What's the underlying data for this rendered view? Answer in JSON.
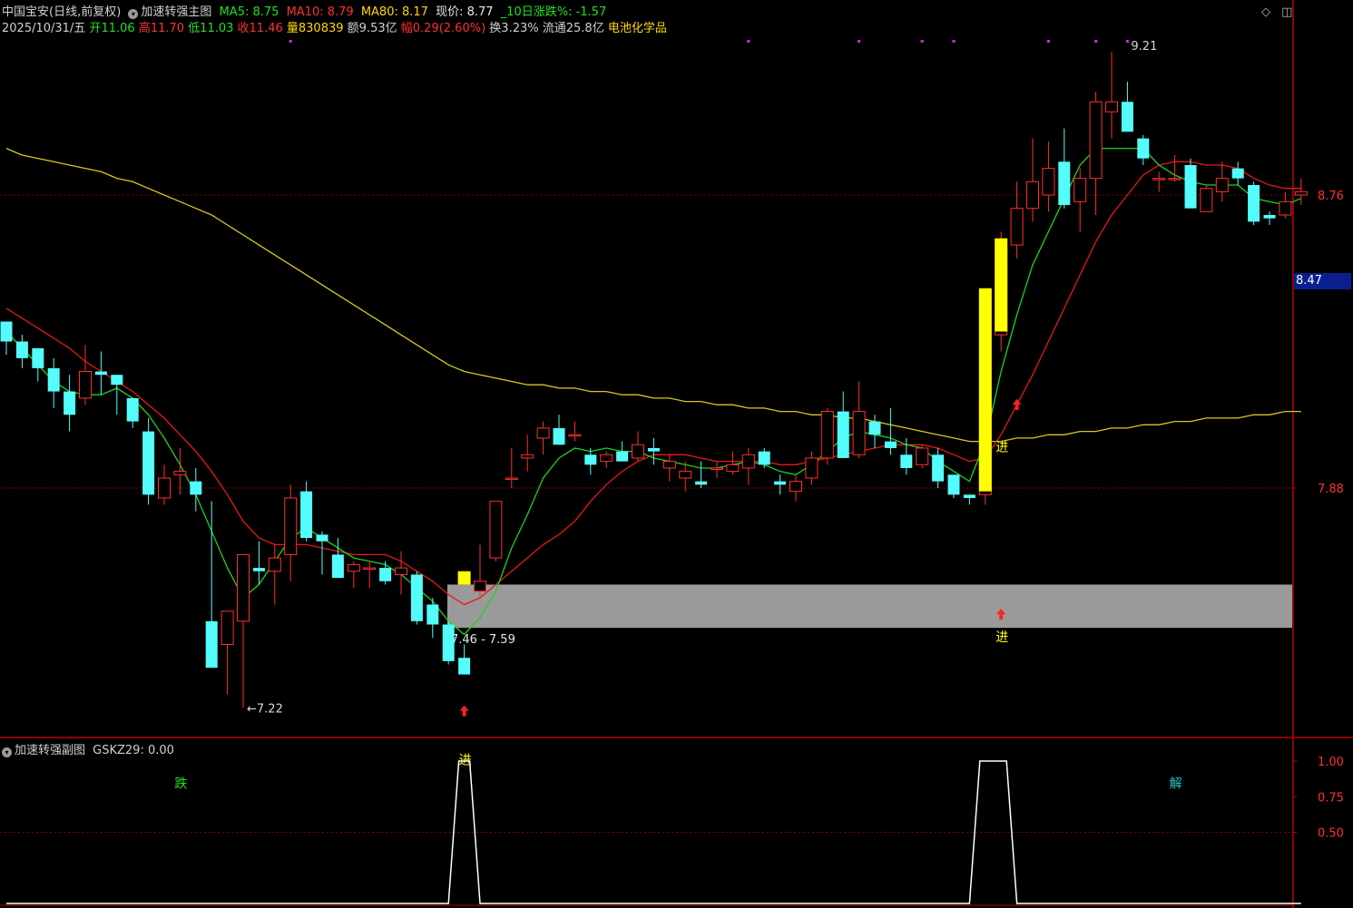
{
  "header": {
    "stock": "中国宝安(日线,前复权)",
    "indicator": "加速转强主图",
    "ma5": "MA5: 8.75",
    "ma10": "MA10: 8.79",
    "ma80": "MA80: 8.17",
    "price": "现价: 8.77",
    "change10": "_10日涨跌%: -1.57"
  },
  "info": {
    "date": "2025/10/31/五",
    "open": "开11.06",
    "high": "高11.70",
    "low": "低11.03",
    "close": "收11.46",
    "volume": "量830839",
    "amount": "额9.53亿",
    "range": "幅0.29(2.60%)",
    "turnover": "换3.23%",
    "float": "流通25.8亿",
    "sector": "电池化学品"
  },
  "sub_header": {
    "indicator": "加速转强副图",
    "value": "GSKZ29: 0.00"
  },
  "current_price_label": "8.47",
  "colors": {
    "up": "#ff3030",
    "down": "#54fcfc",
    "ma5": "#1fd11f",
    "ma10": "#e81818",
    "ma80": "#d8c820",
    "signal": "#ffff00",
    "band": "#9a9a9a",
    "grid": "#8b0000",
    "axis": "#c00000"
  },
  "chart_data": [
    {
      "type": "candlestick",
      "title": "加速转强主图",
      "series_names": [
        "MA5",
        "MA10",
        "MA80"
      ],
      "ylim": [
        7.0,
        9.3
      ],
      "yticks": [
        7.88,
        8.76
      ],
      "candles": [
        {
          "o": 8.38,
          "h": 8.38,
          "l": 8.28,
          "c": 8.32
        },
        {
          "o": 8.32,
          "h": 8.34,
          "l": 8.24,
          "c": 8.27
        },
        {
          "o": 8.3,
          "h": 8.3,
          "l": 8.2,
          "c": 8.24
        },
        {
          "o": 8.24,
          "h": 8.27,
          "l": 8.12,
          "c": 8.17
        },
        {
          "o": 8.17,
          "h": 8.22,
          "l": 8.05,
          "c": 8.1
        },
        {
          "o": 8.15,
          "h": 8.31,
          "l": 8.13,
          "c": 8.23
        },
        {
          "o": 8.23,
          "h": 8.29,
          "l": 8.16,
          "c": 8.22
        },
        {
          "o": 8.22,
          "h": 8.22,
          "l": 8.1,
          "c": 8.19
        },
        {
          "o": 8.15,
          "h": 8.15,
          "l": 8.06,
          "c": 8.08
        },
        {
          "o": 8.05,
          "h": 8.09,
          "l": 7.83,
          "c": 7.86
        },
        {
          "o": 7.85,
          "h": 7.95,
          "l": 7.83,
          "c": 7.91
        },
        {
          "o": 7.92,
          "h": 8.0,
          "l": 7.86,
          "c": 7.93
        },
        {
          "o": 7.9,
          "h": 7.94,
          "l": 7.81,
          "c": 7.86
        },
        {
          "o": 7.48,
          "h": 7.84,
          "l": 7.45,
          "c": 7.34
        },
        {
          "o": 7.41,
          "h": 7.5,
          "l": 7.26,
          "c": 7.51
        },
        {
          "o": 7.48,
          "h": 7.68,
          "l": 7.22,
          "c": 7.68
        },
        {
          "o": 7.64,
          "h": 7.72,
          "l": 7.59,
          "c": 7.63
        },
        {
          "o": 7.63,
          "h": 7.71,
          "l": 7.53,
          "c": 7.67
        },
        {
          "o": 7.68,
          "h": 7.89,
          "l": 7.6,
          "c": 7.85
        },
        {
          "o": 7.87,
          "h": 7.9,
          "l": 7.72,
          "c": 7.73
        },
        {
          "o": 7.74,
          "h": 7.75,
          "l": 7.62,
          "c": 7.72
        },
        {
          "o": 7.68,
          "h": 7.73,
          "l": 7.62,
          "c": 7.61
        },
        {
          "o": 7.63,
          "h": 7.66,
          "l": 7.58,
          "c": 7.65
        },
        {
          "o": 7.64,
          "h": 7.66,
          "l": 7.58,
          "c": 7.64
        },
        {
          "o": 7.64,
          "h": 7.66,
          "l": 7.59,
          "c": 7.6
        },
        {
          "o": 7.62,
          "h": 7.69,
          "l": 7.56,
          "c": 7.64
        },
        {
          "o": 7.62,
          "h": 7.63,
          "l": 7.47,
          "c": 7.48
        },
        {
          "o": 7.53,
          "h": 7.55,
          "l": 7.43,
          "c": 7.47
        },
        {
          "o": 7.47,
          "h": 7.48,
          "l": 7.35,
          "c": 7.36
        },
        {
          "o": 7.37,
          "h": 7.41,
          "l": 7.33,
          "c": 7.32
        },
        {
          "o": 7.57,
          "h": 7.71,
          "l": 7.55,
          "c": 7.6
        },
        {
          "o": 7.67,
          "h": 7.84,
          "l": 7.66,
          "c": 7.84
        },
        {
          "o": 7.91,
          "h": 8.0,
          "l": 7.88,
          "c": 7.91
        },
        {
          "o": 7.97,
          "h": 8.04,
          "l": 7.93,
          "c": 7.98
        },
        {
          "o": 8.03,
          "h": 8.08,
          "l": 7.98,
          "c": 8.06
        },
        {
          "o": 8.06,
          "h": 8.1,
          "l": 8.01,
          "c": 8.01
        },
        {
          "o": 8.04,
          "h": 8.08,
          "l": 8.02,
          "c": 8.04
        },
        {
          "o": 7.98,
          "h": 8.0,
          "l": 7.92,
          "c": 7.95
        },
        {
          "o": 7.96,
          "h": 7.99,
          "l": 7.94,
          "c": 7.98
        },
        {
          "o": 7.99,
          "h": 8.02,
          "l": 7.96,
          "c": 7.96
        },
        {
          "o": 7.97,
          "h": 8.05,
          "l": 7.96,
          "c": 8.01
        },
        {
          "o": 8.0,
          "h": 8.03,
          "l": 7.95,
          "c": 7.99
        },
        {
          "o": 7.94,
          "h": 7.98,
          "l": 7.9,
          "c": 7.96
        },
        {
          "o": 7.91,
          "h": 7.96,
          "l": 7.87,
          "c": 7.93
        },
        {
          "o": 7.9,
          "h": 7.96,
          "l": 7.88,
          "c": 7.89
        },
        {
          "o": 7.94,
          "h": 7.96,
          "l": 7.91,
          "c": 7.94
        },
        {
          "o": 7.93,
          "h": 7.99,
          "l": 7.92,
          "c": 7.95
        },
        {
          "o": 7.94,
          "h": 8.0,
          "l": 7.89,
          "c": 7.98
        },
        {
          "o": 7.99,
          "h": 8.0,
          "l": 7.94,
          "c": 7.95
        },
        {
          "o": 7.9,
          "h": 7.92,
          "l": 7.86,
          "c": 7.89
        },
        {
          "o": 7.87,
          "h": 7.92,
          "l": 7.84,
          "c": 7.9
        },
        {
          "o": 7.91,
          "h": 7.99,
          "l": 7.89,
          "c": 7.97
        },
        {
          "o": 7.97,
          "h": 8.12,
          "l": 7.95,
          "c": 8.11
        },
        {
          "o": 8.11,
          "h": 8.17,
          "l": 7.98,
          "c": 7.97
        },
        {
          "o": 7.98,
          "h": 8.2,
          "l": 7.97,
          "c": 8.11
        },
        {
          "o": 8.08,
          "h": 8.1,
          "l": 8.0,
          "c": 8.04
        },
        {
          "o": 8.02,
          "h": 8.12,
          "l": 7.98,
          "c": 8.0
        },
        {
          "o": 7.98,
          "h": 8.03,
          "l": 7.92,
          "c": 7.94
        },
        {
          "o": 7.95,
          "h": 8.01,
          "l": 7.94,
          "c": 8.0
        },
        {
          "o": 7.98,
          "h": 8.0,
          "l": 7.88,
          "c": 7.9
        },
        {
          "o": 7.92,
          "h": 7.92,
          "l": 7.85,
          "c": 7.86
        },
        {
          "o": 7.86,
          "h": 7.86,
          "l": 7.83,
          "c": 7.85
        },
        {
          "o": 7.86,
          "h": 8.18,
          "l": 7.83,
          "c": 8.14
        },
        {
          "o": 8.34,
          "h": 8.65,
          "l": 8.29,
          "c": 8.61
        },
        {
          "o": 8.61,
          "h": 8.8,
          "l": 8.57,
          "c": 8.72
        },
        {
          "o": 8.72,
          "h": 8.93,
          "l": 8.68,
          "c": 8.8
        },
        {
          "o": 8.76,
          "h": 8.92,
          "l": 8.71,
          "c": 8.84
        },
        {
          "o": 8.86,
          "h": 8.96,
          "l": 8.72,
          "c": 8.73
        },
        {
          "o": 8.74,
          "h": 8.84,
          "l": 8.65,
          "c": 8.81
        },
        {
          "o": 8.81,
          "h": 9.07,
          "l": 8.7,
          "c": 9.04
        },
        {
          "o": 9.01,
          "h": 9.19,
          "l": 8.93,
          "c": 9.04
        },
        {
          "o": 9.04,
          "h": 9.1,
          "l": 8.96,
          "c": 8.95
        },
        {
          "o": 8.93,
          "h": 8.94,
          "l": 8.85,
          "c": 8.87
        },
        {
          "o": 8.81,
          "h": 8.83,
          "l": 8.77,
          "c": 8.81
        },
        {
          "o": 8.81,
          "h": 8.88,
          "l": 8.8,
          "c": 8.81
        },
        {
          "o": 8.85,
          "h": 8.87,
          "l": 8.72,
          "c": 8.72
        },
        {
          "o": 8.71,
          "h": 8.79,
          "l": 8.71,
          "c": 8.78
        },
        {
          "o": 8.77,
          "h": 8.86,
          "l": 8.74,
          "c": 8.81
        },
        {
          "o": 8.84,
          "h": 8.86,
          "l": 8.79,
          "c": 8.81
        },
        {
          "o": 8.79,
          "h": 8.8,
          "l": 8.67,
          "c": 8.68
        },
        {
          "o": 8.7,
          "h": 8.71,
          "l": 8.67,
          "c": 8.69
        },
        {
          "o": 8.7,
          "h": 8.77,
          "l": 8.69,
          "c": 8.74
        },
        {
          "o": 8.76,
          "h": 8.81,
          "l": 8.73,
          "c": 8.77
        }
      ],
      "ma5": [
        8.35,
        8.3,
        8.25,
        8.2,
        8.17,
        8.16,
        8.16,
        8.18,
        8.15,
        8.1,
        8.03,
        7.95,
        7.86,
        7.75,
        7.64,
        7.55,
        7.59,
        7.66,
        7.73,
        7.76,
        7.73,
        7.7,
        7.67,
        7.66,
        7.65,
        7.62,
        7.58,
        7.54,
        7.48,
        7.44,
        7.49,
        7.57,
        7.7,
        7.8,
        7.91,
        7.97,
        8.0,
        7.99,
        8.0,
        7.99,
        7.99,
        7.97,
        7.96,
        7.95,
        7.94,
        7.94,
        7.95,
        7.96,
        7.95,
        7.93,
        7.92,
        7.95,
        7.99,
        8.03,
        8.05,
        8.04,
        8.03,
        8.01,
        8.0,
        7.96,
        7.93,
        7.9,
        8.02,
        8.23,
        8.4,
        8.55,
        8.65,
        8.75,
        8.85,
        8.9,
        8.9,
        8.9,
        8.9,
        8.85,
        8.82,
        8.8,
        8.79,
        8.79,
        8.79,
        8.75,
        8.74,
        8.73,
        8.75
      ],
      "ma10": [
        8.42,
        8.39,
        8.36,
        8.33,
        8.3,
        8.26,
        8.23,
        8.2,
        8.17,
        8.13,
        8.09,
        8.04,
        7.99,
        7.93,
        7.86,
        7.78,
        7.73,
        7.71,
        7.71,
        7.71,
        7.7,
        7.69,
        7.68,
        7.68,
        7.68,
        7.66,
        7.63,
        7.6,
        7.56,
        7.53,
        7.55,
        7.59,
        7.63,
        7.67,
        7.71,
        7.74,
        7.78,
        7.84,
        7.89,
        7.93,
        7.96,
        7.98,
        7.98,
        7.98,
        7.97,
        7.96,
        7.96,
        7.96,
        7.96,
        7.95,
        7.95,
        7.96,
        7.97,
        7.98,
        7.99,
        8.0,
        8.01,
        8.01,
        8.01,
        8.0,
        7.98,
        7.96,
        7.97,
        8.04,
        8.13,
        8.22,
        8.32,
        8.42,
        8.52,
        8.62,
        8.7,
        8.76,
        8.82,
        8.85,
        8.86,
        8.86,
        8.85,
        8.85,
        8.84,
        8.81,
        8.79,
        8.78,
        8.78
      ],
      "ma80": [
        8.9,
        8.88,
        8.87,
        8.86,
        8.85,
        8.84,
        8.83,
        8.81,
        8.8,
        8.78,
        8.76,
        8.74,
        8.72,
        8.7,
        8.67,
        8.64,
        8.61,
        8.58,
        8.55,
        8.52,
        8.49,
        8.46,
        8.43,
        8.4,
        8.37,
        8.34,
        8.31,
        8.28,
        8.25,
        8.23,
        8.22,
        8.21,
        8.2,
        8.19,
        8.19,
        8.18,
        8.18,
        8.17,
        8.17,
        8.16,
        8.16,
        8.15,
        8.15,
        8.14,
        8.14,
        8.13,
        8.13,
        8.12,
        8.12,
        8.11,
        8.11,
        8.1,
        8.1,
        8.09,
        8.09,
        8.08,
        8.07,
        8.06,
        8.05,
        8.04,
        8.03,
        8.02,
        8.02,
        8.02,
        8.03,
        8.03,
        8.04,
        8.04,
        8.05,
        8.05,
        8.06,
        8.06,
        8.07,
        8.07,
        8.08,
        8.08,
        8.09,
        8.09,
        8.09,
        8.1,
        8.1,
        8.11,
        8.11
      ],
      "big_bars": [
        {
          "index": 62,
          "low": 7.87,
          "high": 8.48
        },
        {
          "index": 63,
          "low": 8.35,
          "high": 8.63
        }
      ],
      "small_square": {
        "index": 29,
        "low": 7.59,
        "high": 7.63
      },
      "band": {
        "low": 7.46,
        "high": 7.59,
        "label": "7.46 - 7.59"
      },
      "price_labels": [
        {
          "index": 15,
          "value": 7.22,
          "label": "←7.22"
        },
        {
          "index": 71,
          "value": 9.21,
          "label": "9.21"
        }
      ],
      "text_marks": [
        {
          "index": 11,
          "y": 6.98,
          "label": "跌",
          "color": "#21e021"
        },
        {
          "index": 29,
          "y": 7.05,
          "label": "进",
          "color": "#ffff00"
        },
        {
          "index": 63,
          "y": 7.42,
          "label": "进",
          "color": "#ffff00"
        },
        {
          "index": 63,
          "y": 7.99,
          "label": "进",
          "color": "#ffff00"
        },
        {
          "index": 74,
          "y": 6.98,
          "label": "解",
          "color": "#26c6c6"
        }
      ]
    },
    {
      "type": "line",
      "title": "加速转强副图",
      "series_names": [
        "GSKZ29"
      ],
      "ylim": [
        0,
        1.15
      ],
      "yticks": [
        0.5,
        0.75,
        1.0
      ],
      "ytick_labels": [
        "0.50",
        "0.75",
        "1.00"
      ],
      "values": [
        0,
        0,
        0,
        0,
        0,
        0,
        0,
        0,
        0,
        0,
        0,
        0,
        0,
        0,
        0,
        0,
        0,
        0,
        0,
        0,
        0,
        0,
        0,
        0,
        0,
        0,
        0,
        0,
        0,
        1,
        0,
        0,
        0,
        0,
        0,
        0,
        0,
        0,
        0,
        0,
        0,
        0,
        0,
        0,
        0,
        0,
        0,
        0,
        0,
        0,
        0,
        0,
        0,
        0,
        0,
        0,
        0,
        0,
        0,
        0,
        0,
        0,
        1,
        1,
        0,
        0,
        0,
        0,
        0,
        0,
        0,
        0,
        0,
        0,
        0,
        0,
        0,
        0,
        0,
        0,
        0,
        0,
        0
      ]
    }
  ]
}
